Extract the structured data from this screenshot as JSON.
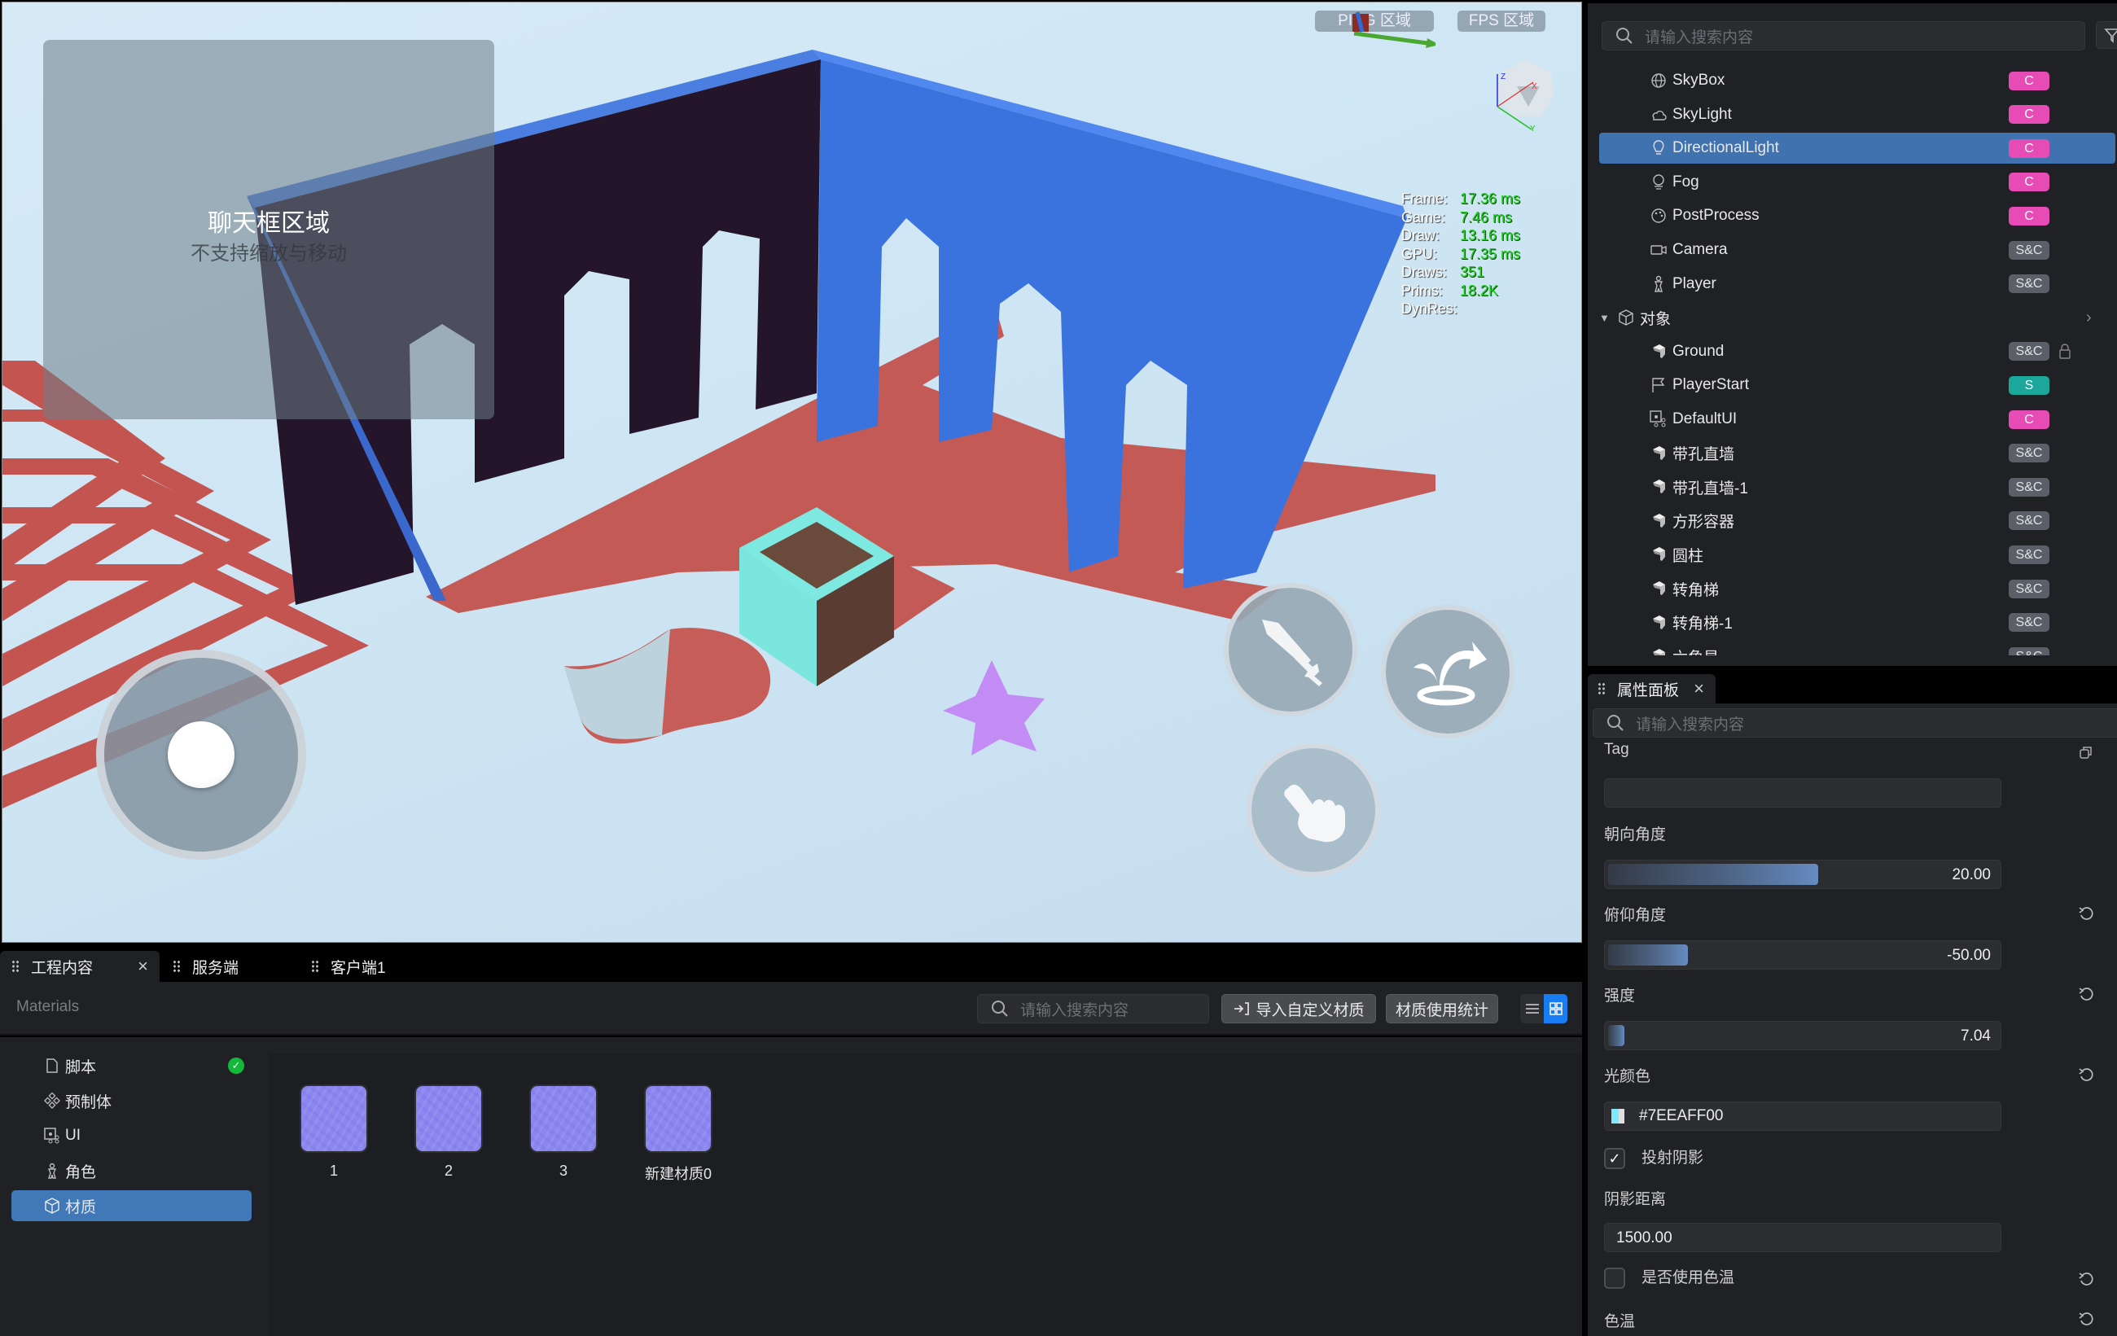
{
  "viewport": {
    "chat_area": {
      "title": "聊天框区域",
      "subtitle": "不支持缩放与移动"
    },
    "hud": {
      "ping_label": "PING 区域",
      "fps_label": "FPS 区域"
    },
    "gizmo_axes": {
      "x": "X",
      "y": "Y",
      "z": "Z"
    },
    "stats": [
      {
        "key": "Frame:",
        "value": "17.36 ms"
      },
      {
        "key": "Game:",
        "value": "7.46 ms"
      },
      {
        "key": "Draw:",
        "value": "13.16 ms"
      },
      {
        "key": "GPU:",
        "value": "17.35 ms"
      },
      {
        "key": "Draws:",
        "value": "351"
      },
      {
        "key": "Prims:",
        "value": "18.2K"
      },
      {
        "key": "DynRes:",
        "value": ""
      }
    ],
    "controls": {
      "joystick": "joystick",
      "attack": "sword-icon",
      "jump": "jump-icon",
      "interact": "hand-pointer-icon"
    },
    "colors": {
      "walls": "#3f78e6",
      "shadow": "#c45a55",
      "box": "#7ee8e0",
      "star": "#c080f0"
    }
  },
  "bottom_panel": {
    "tabs": [
      {
        "label": "工程内容",
        "active": true,
        "closable": true
      },
      {
        "label": "服务端",
        "active": false
      },
      {
        "label": "客户端1",
        "active": false
      }
    ],
    "breadcrumb": "Materials",
    "search": {
      "placeholder": "请输入搜索内容",
      "value": ""
    },
    "import_button": "导入自定义材质",
    "stats_button": "材质使用统计",
    "view_mode": "grid",
    "tree": [
      {
        "label": "脚本",
        "icon": "file-icon",
        "status": "ok",
        "selected": false
      },
      {
        "label": "预制体",
        "icon": "prefab-icon",
        "selected": false
      },
      {
        "label": "UI",
        "icon": "ui-icon",
        "selected": false
      },
      {
        "label": "角色",
        "icon": "character-icon",
        "selected": false
      },
      {
        "label": "材质",
        "icon": "material-icon",
        "selected": true
      }
    ],
    "materials": [
      {
        "name": "1"
      },
      {
        "name": "2"
      },
      {
        "name": "3"
      },
      {
        "name": "新建材质0"
      }
    ]
  },
  "hierarchy": {
    "search": {
      "placeholder": "请输入搜索内容",
      "value": ""
    },
    "items": [
      {
        "label": "SkyBox",
        "icon": "globe-icon",
        "badge": "C",
        "badge_type": "c"
      },
      {
        "label": "SkyLight",
        "icon": "cloud-icon",
        "badge": "C",
        "badge_type": "c"
      },
      {
        "label": "DirectionalLight",
        "icon": "bulb-icon",
        "badge": "C",
        "badge_type": "c",
        "selected": true
      },
      {
        "label": "Fog",
        "icon": "fog-icon",
        "badge": "C",
        "badge_type": "c"
      },
      {
        "label": "PostProcess",
        "icon": "palette-icon",
        "badge": "C",
        "badge_type": "c"
      },
      {
        "label": "Camera",
        "icon": "camera-icon",
        "badge": "S&C",
        "badge_type": "sc"
      },
      {
        "label": "Player",
        "icon": "player-icon",
        "badge": "S&C",
        "badge_type": "sc"
      }
    ],
    "group": {
      "label": "对象",
      "expanded": true
    },
    "objects": [
      {
        "label": "Ground",
        "icon": "mesh-icon",
        "badge": "S&C",
        "badge_type": "sc",
        "locked": true
      },
      {
        "label": "PlayerStart",
        "icon": "flag-icon",
        "badge": "S",
        "badge_type": "s"
      },
      {
        "label": "DefaultUI",
        "icon": "ui-icon",
        "badge": "C",
        "badge_type": "c"
      },
      {
        "label": "带孔直墙",
        "icon": "mesh-icon",
        "badge": "S&C",
        "badge_type": "sc"
      },
      {
        "label": "带孔直墙-1",
        "icon": "mesh-icon",
        "badge": "S&C",
        "badge_type": "sc"
      },
      {
        "label": "方形容器",
        "icon": "mesh-icon",
        "badge": "S&C",
        "badge_type": "sc"
      },
      {
        "label": "圆柱",
        "icon": "mesh-icon",
        "badge": "S&C",
        "badge_type": "sc"
      },
      {
        "label": "转角梯",
        "icon": "mesh-icon",
        "badge": "S&C",
        "badge_type": "sc"
      },
      {
        "label": "转角梯-1",
        "icon": "mesh-icon",
        "badge": "S&C",
        "badge_type": "sc"
      },
      {
        "label": "六角星",
        "icon": "mesh-icon",
        "badge": "S&C",
        "badge_type": "sc"
      }
    ]
  },
  "properties": {
    "tab_label": "属性面板",
    "search": {
      "placeholder": "请输入搜索内容",
      "value": ""
    },
    "tag": {
      "label": "Tag",
      "value": ""
    },
    "yaw": {
      "label": "朝向角度",
      "value": "20.00",
      "fill_fraction": 0.54
    },
    "pitch": {
      "label": "俯仰角度",
      "value": "-50.00",
      "fill_fraction": 0.21
    },
    "intensity": {
      "label": "强度",
      "value": "7.04",
      "fill_fraction": 0.05
    },
    "light_color": {
      "label": "光颜色",
      "value": "#7EEAFF00",
      "swatch": "#7EEAFF"
    },
    "cast_shadow": {
      "label": "投射阴影",
      "checked": true
    },
    "shadow_distance": {
      "label": "阴影距离",
      "value": "1500.00"
    },
    "use_temperature": {
      "label": "是否使用色温",
      "checked": false
    },
    "temperature": {
      "label": "色温"
    }
  }
}
